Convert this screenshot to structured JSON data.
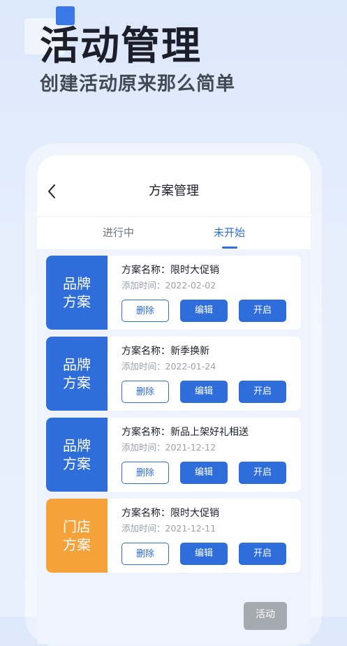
{
  "hero": {
    "title": "活动管理",
    "subtitle": "创建活动原来那么简单"
  },
  "nav": {
    "back_icon": "chevron-left-icon",
    "title": "方案管理"
  },
  "tabs": [
    {
      "label": "进行中",
      "active": false
    },
    {
      "label": "未开始",
      "active": true
    }
  ],
  "colors": {
    "accent": "#2f6ddb",
    "tag_blue": "#2f6ddb",
    "tag_orange": "#f5a23a"
  },
  "plans": [
    {
      "tag_line1": "品牌",
      "tag_line2": "方案",
      "tag_color": "blue",
      "name": "方案名称：限时大促销",
      "time": "添加时间：2022-02-02",
      "delete_label": "删除",
      "edit_label": "编辑",
      "start_label": "开启"
    },
    {
      "tag_line1": "品牌",
      "tag_line2": "方案",
      "tag_color": "blue",
      "name": "方案名称：新季换新",
      "time": "添加时间：2022-01-24",
      "delete_label": "删除",
      "edit_label": "编辑",
      "start_label": "开启"
    },
    {
      "tag_line1": "品牌",
      "tag_line2": "方案",
      "tag_color": "blue",
      "name": "方案名称：新品上架好礼相送",
      "time": "添加时间：2021-12-12",
      "delete_label": "删除",
      "edit_label": "编辑",
      "start_label": "开启"
    },
    {
      "tag_line1": "门店",
      "tag_line2": "方案",
      "tag_color": "orange",
      "name": "方案名称：限时大促销",
      "time": "添加时间：2021-12-11",
      "delete_label": "删除",
      "edit_label": "编辑",
      "start_label": "开启"
    }
  ],
  "bottom_button": {
    "label": "活动"
  }
}
